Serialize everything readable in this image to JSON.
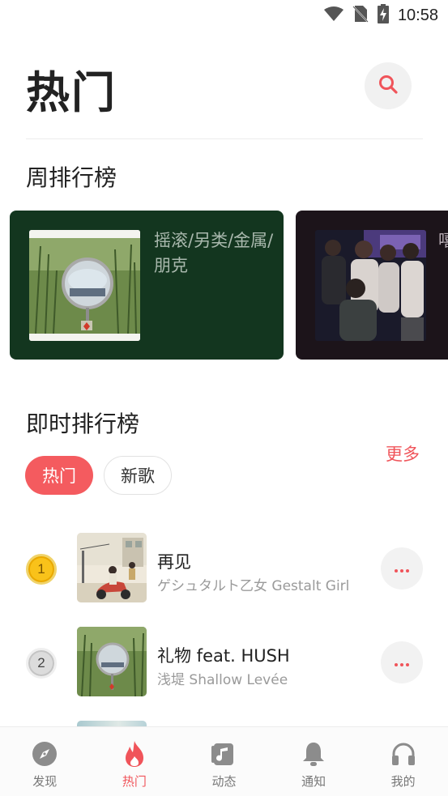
{
  "status_bar": {
    "time": "10:58"
  },
  "header": {
    "title": "热门"
  },
  "weekly_chart": {
    "title": "周排行榜",
    "cards": [
      {
        "label": "摇滚/另类/金属/朋克"
      },
      {
        "label": "嘻哈/说唱/电子"
      }
    ]
  },
  "realtime_chart": {
    "title": "即时排行榜",
    "more_label": "更多",
    "filters": [
      {
        "label": "热门",
        "selected": true
      },
      {
        "label": "新歌",
        "selected": false
      }
    ],
    "songs": [
      {
        "rank": "1",
        "title": "再见",
        "artist": "ゲシュタルト乙女 Gestalt Girl"
      },
      {
        "rank": "2",
        "title": "礼物 feat. HUSH",
        "artist": "浅堤 Shallow Levée"
      }
    ]
  },
  "tab_bar": {
    "items": [
      {
        "label": "发现",
        "icon": "compass-icon"
      },
      {
        "label": "热门",
        "icon": "flame-icon",
        "active": true
      },
      {
        "label": "动态",
        "icon": "music-note-icon"
      },
      {
        "label": "通知",
        "icon": "bell-icon"
      },
      {
        "label": "我的",
        "icon": "headphones-icon"
      }
    ]
  },
  "colors": {
    "accent": "#f0545a",
    "card_green": "#13361f",
    "card_dark": "#1c141a"
  }
}
